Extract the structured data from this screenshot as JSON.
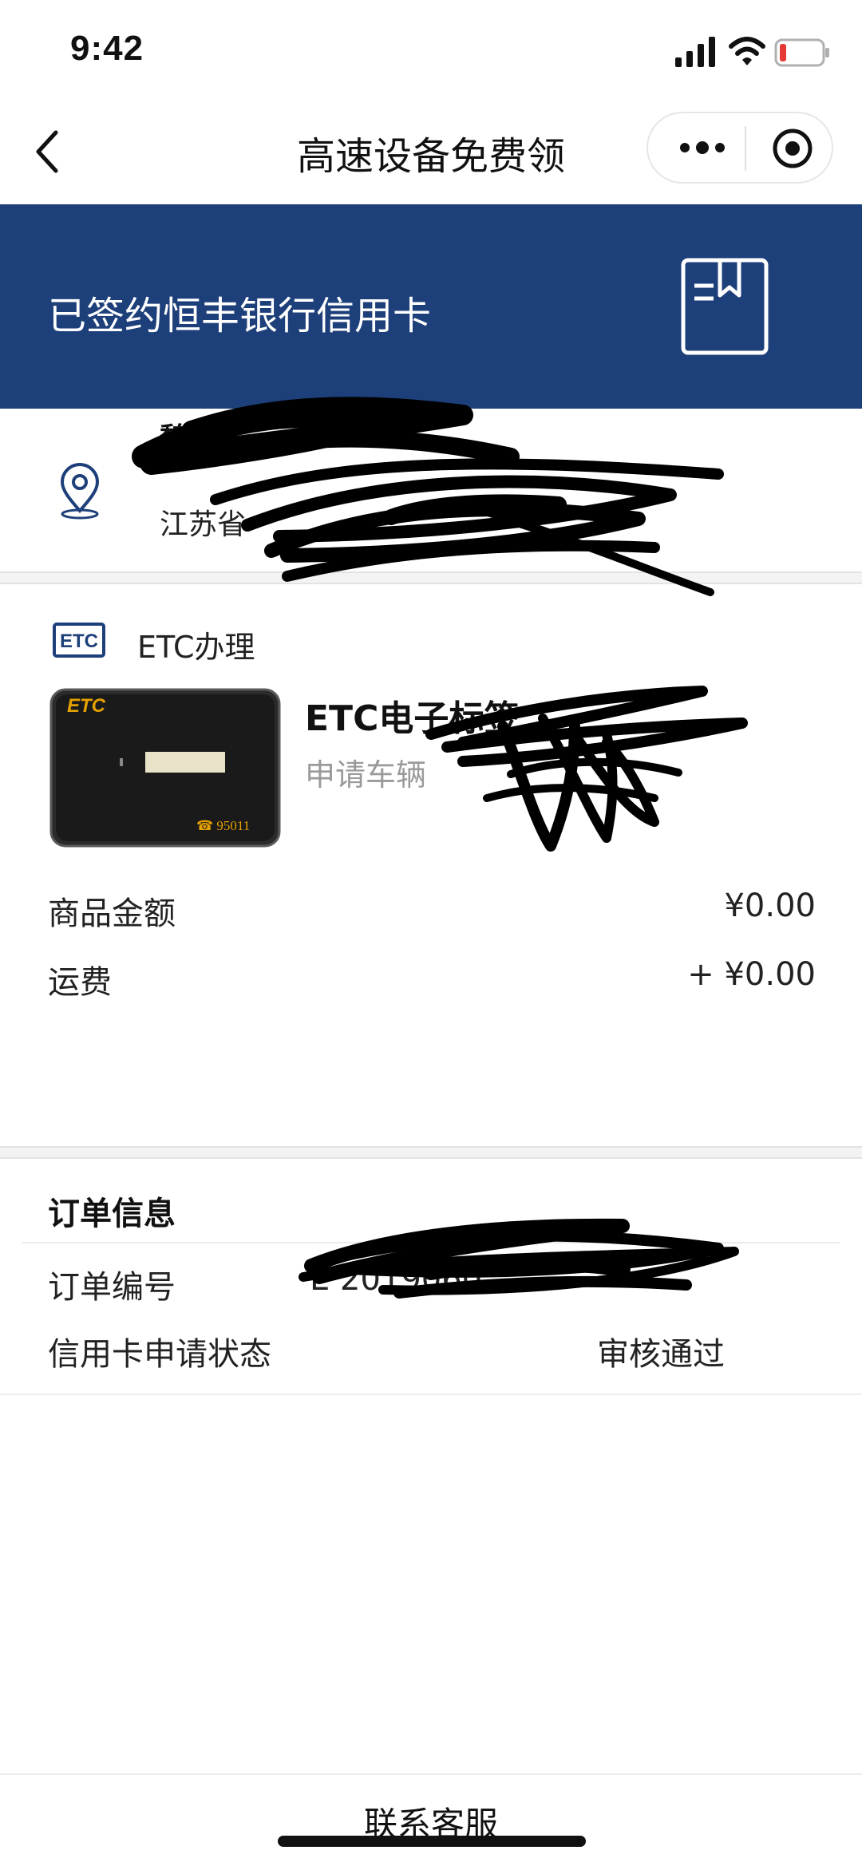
{
  "status_bar": {
    "time": "9:42"
  },
  "nav": {
    "title": "高速设备免费领"
  },
  "banner": {
    "title": "已签约恒丰银行信用卡",
    "background_color": "#1d3f7a"
  },
  "address": {
    "name_line": "魏",
    "address_line": "江苏省"
  },
  "etc_section": {
    "heading": "ETC办理",
    "badge_text": "ETC",
    "product_name": "ETC电子标签",
    "product_subtitle": "申请车辆",
    "device_brand": "ETC",
    "device_phone": "☎ 95011"
  },
  "price_rows": [
    {
      "label": "商品金额",
      "value": "¥0.00"
    },
    {
      "label": "运费",
      "value": "+ ¥0.00"
    }
  ],
  "order_info": {
    "title": "订单信息",
    "rows": [
      {
        "label": "订单编号",
        "value": "E 2019060"
      },
      {
        "label": "信用卡申请状态",
        "value": "审核通过"
      }
    ]
  },
  "footer": {
    "contact_label": "联系客服"
  }
}
